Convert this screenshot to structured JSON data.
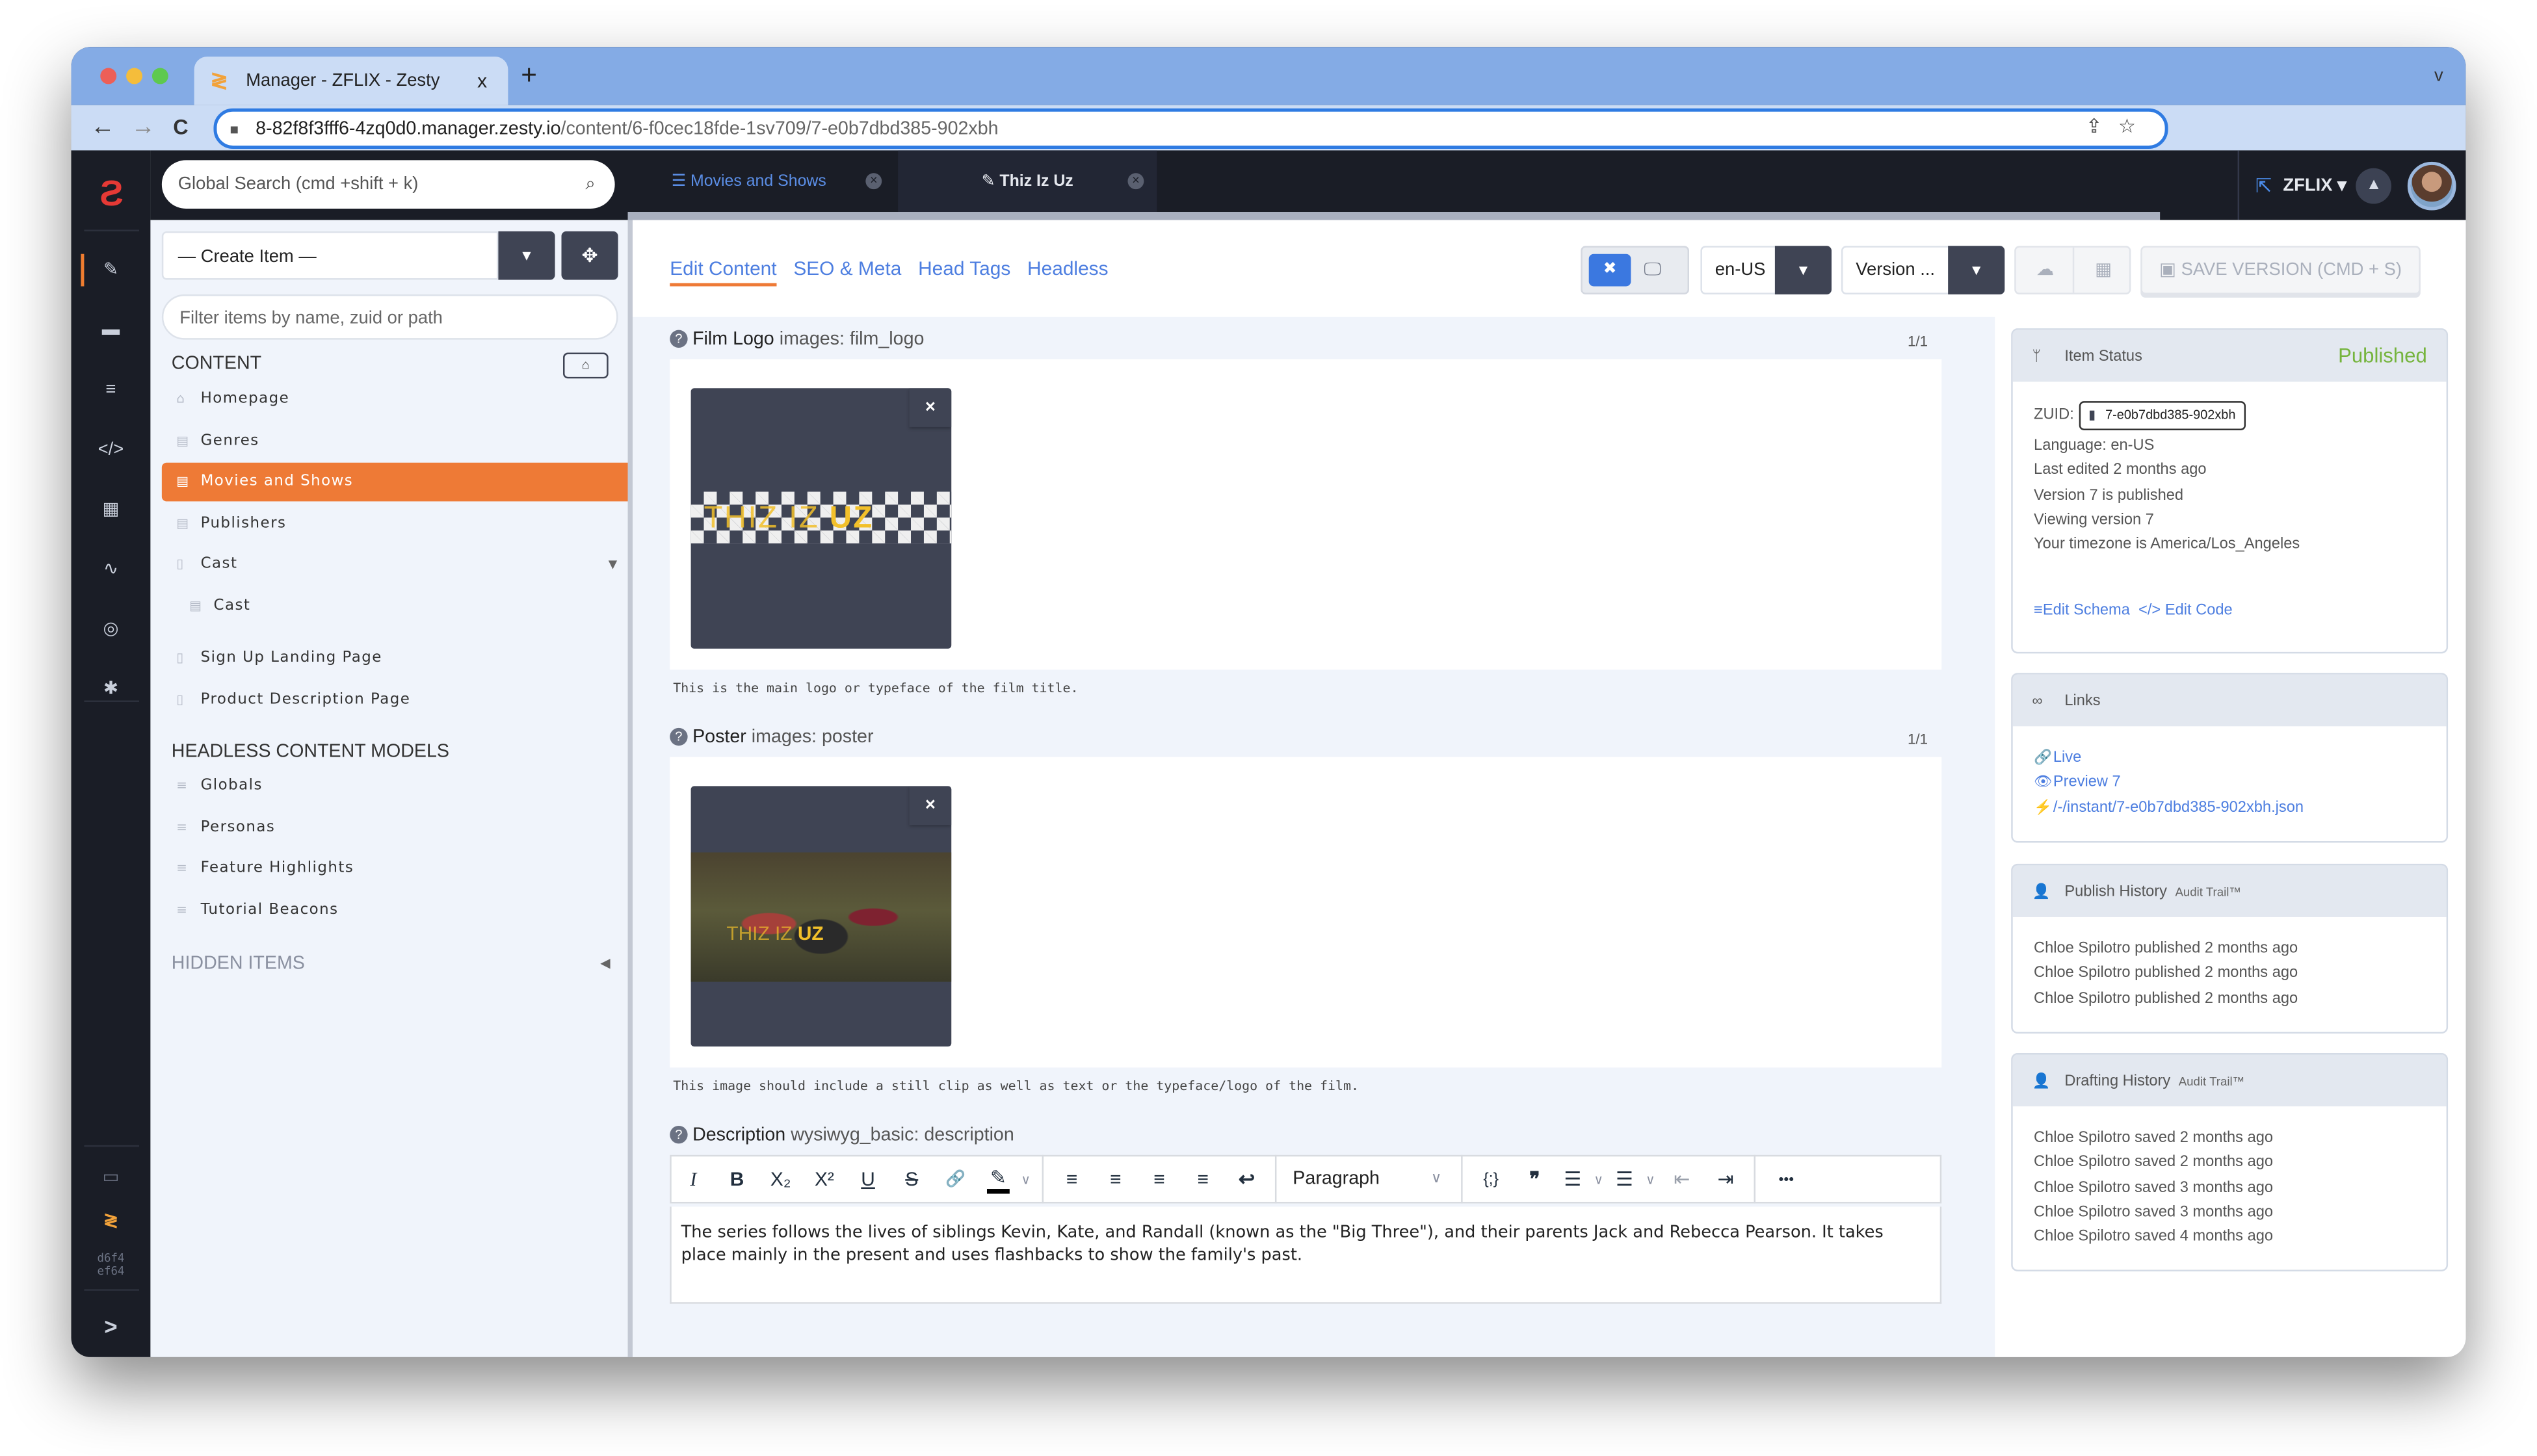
{
  "browser": {
    "tab_title": "Manager - ZFLIX - Zesty",
    "tab_close": "x",
    "new_tab": "+",
    "tabs_menu": "v",
    "url_host": "8-82f8f3fff6-4zq0d0.manager.zesty.io",
    "url_path": "/content/6-f0cec18fde-1sv709/7-e0b7dbd385-902xbh",
    "back": "←",
    "forward": "→",
    "reload": "C",
    "share_icon": "⇪",
    "star_icon": "☆"
  },
  "rail": {
    "items": [
      {
        "icon": "edit-content",
        "glyph": "✎",
        "active": true
      },
      {
        "icon": "media",
        "glyph": "▬",
        "active": false
      },
      {
        "icon": "schema",
        "glyph": "≡",
        "active": false
      },
      {
        "icon": "code",
        "glyph": "</>",
        "active": false
      },
      {
        "icon": "leads",
        "glyph": "▦",
        "active": false
      },
      {
        "icon": "analytics",
        "glyph": "∿",
        "active": false
      },
      {
        "icon": "seo",
        "glyph": "◎",
        "active": false
      },
      {
        "icon": "settings",
        "glyph": "✱",
        "active": false
      }
    ],
    "docs_glyph": "▭",
    "brand_glyph": "≷",
    "hash_line1": "d6f4",
    "hash_line2": "ef64",
    "expand_glyph": ">"
  },
  "topbar": {
    "search_placeholder": "Global Search (cmd +shift + k)",
    "search_icon": "⌕",
    "open_tabs": [
      {
        "label": "Movies and Shows",
        "icon": "☰"
      },
      {
        "label": "Thiz Iz Uz",
        "icon": "✎"
      }
    ],
    "instance_name": "ZFLIX ▾",
    "external_icon": "⇱",
    "bell_icon": "🔔"
  },
  "nav": {
    "create_item": "— Create Item —",
    "create_dd": "▼",
    "move_icon": "✥",
    "filter_placeholder": "Filter items by name, zuid or path",
    "content_title": "CONTENT",
    "home_icon": "⌂",
    "content_items": [
      {
        "label": "Homepage",
        "icon": "⌂",
        "active": false
      },
      {
        "label": "Genres",
        "icon": "▤",
        "active": false
      },
      {
        "label": "Movies and Shows",
        "icon": "▤",
        "active": true
      },
      {
        "label": "Publishers",
        "icon": "▤",
        "active": false
      },
      {
        "label": "Cast",
        "icon": "▯",
        "active": false,
        "caret": "▼"
      },
      {
        "label": "Cast",
        "icon": "▤",
        "active": false,
        "child": true
      },
      {
        "label": "Sign Up Landing Page",
        "icon": "▯",
        "active": false
      },
      {
        "label": "Product Description Page",
        "icon": "▯",
        "active": false
      }
    ],
    "headless_title": "HEADLESS CONTENT MODELS",
    "headless_items": [
      {
        "label": "Globals",
        "icon": "≡"
      },
      {
        "label": "Personas",
        "icon": "≡"
      },
      {
        "label": "Feature Highlights",
        "icon": "≡"
      },
      {
        "label": "Tutorial Beacons",
        "icon": "≡"
      }
    ],
    "hidden_title": "HIDDEN ITEMS",
    "hidden_caret": "◀"
  },
  "main": {
    "subtabs": [
      "Edit Content",
      "SEO & Meta",
      "Head Tags",
      "Headless"
    ],
    "active_subtab": "Edit Content",
    "view_toggle": {
      "edit_icon": "✖",
      "preview_icon": "🖵"
    },
    "language": "en-US",
    "version": "Version ...",
    "dd_glyph": "▼",
    "publish_icon": "☁",
    "schedule_icon": "▦",
    "save_label": "SAVE VERSION (CMD + S)",
    "save_icon": "▣"
  },
  "fields": {
    "film_logo": {
      "label": "Film Logo",
      "meta": "images: film_logo",
      "counter": "1/1",
      "image_text_thin": "THIZ IZ ",
      "image_text_bold": "UZ",
      "remove": "×",
      "caption": "This is the main logo or typeface of the film title."
    },
    "poster": {
      "label": "Poster",
      "meta": "images: poster",
      "counter": "1/1",
      "image_text_thin": "THIZ IZ ",
      "image_text_bold": "UZ",
      "remove": "×",
      "caption": "This image should include a still clip as well as text or the typeface/logo of the film."
    },
    "description": {
      "label": "Description",
      "meta": "wysiwyg_basic: description",
      "format": "Paragraph",
      "toolbar": {
        "italic": "I",
        "bold": "B",
        "subscript": "X₂",
        "superscript": "X²",
        "underline": "U",
        "strike": "S",
        "link": "🔗",
        "highlight": "✎",
        "align_left": "≡",
        "align_center": "≡",
        "align_right": "≡",
        "justify": "≡",
        "undo": "↩",
        "code": "{;}",
        "quote": "❞",
        "bullets": "☰",
        "numbers": "☰",
        "outdent": "⇤",
        "indent": "⇥",
        "more": "•••",
        "chev": "∨"
      },
      "value": "The series follows the lives of siblings Kevin, Kate, and Randall (known as the \"Big Three\"), and their parents Jack and Rebecca Pearson. It takes place mainly in the present and uses flashbacks to show the family's past."
    }
  },
  "status": {
    "title": "Item Status",
    "badge": "Published",
    "badge_color": "#75b43d",
    "zuid_label": "ZUID:",
    "zuid": "7-e0b7dbd385-902xbh",
    "lines": [
      "Language: en-US",
      "Last edited 2 months ago",
      "Version 7 is published",
      "Viewing version 7",
      "Your timezone is America/Los_Angeles"
    ],
    "edit_schema": "Edit Schema",
    "edit_code": "Edit Code"
  },
  "links": {
    "title": "Links",
    "items": [
      {
        "icon": "link-icon",
        "glyph": "🔗",
        "label": "Live"
      },
      {
        "icon": "eye-icon",
        "glyph": "👁",
        "label": "Preview 7"
      },
      {
        "icon": "bolt-icon",
        "glyph": "⚡",
        "label": "/-/instant/7-e0b7dbd385-902xbh.json"
      }
    ]
  },
  "publish_history": {
    "title": "Publish History",
    "audit": "Audit Trail™",
    "entries": [
      "Chloe Spilotro published 2 months ago",
      "Chloe Spilotro published 2 months ago",
      "Chloe Spilotro published 2 months ago"
    ]
  },
  "drafting_history": {
    "title": "Drafting History",
    "audit": "Audit Trail™",
    "entries": [
      "Chloe Spilotro saved 2 months ago",
      "Chloe Spilotro saved 2 months ago",
      "Chloe Spilotro saved 3 months ago",
      "Chloe Spilotro saved 3 months ago",
      "Chloe Spilotro saved 4 months ago"
    ]
  },
  "colors": {
    "accent_orange": "#ee7a36",
    "link_blue": "#4d7ee0",
    "dark": "#1a1d26",
    "published_green": "#75b43d"
  }
}
